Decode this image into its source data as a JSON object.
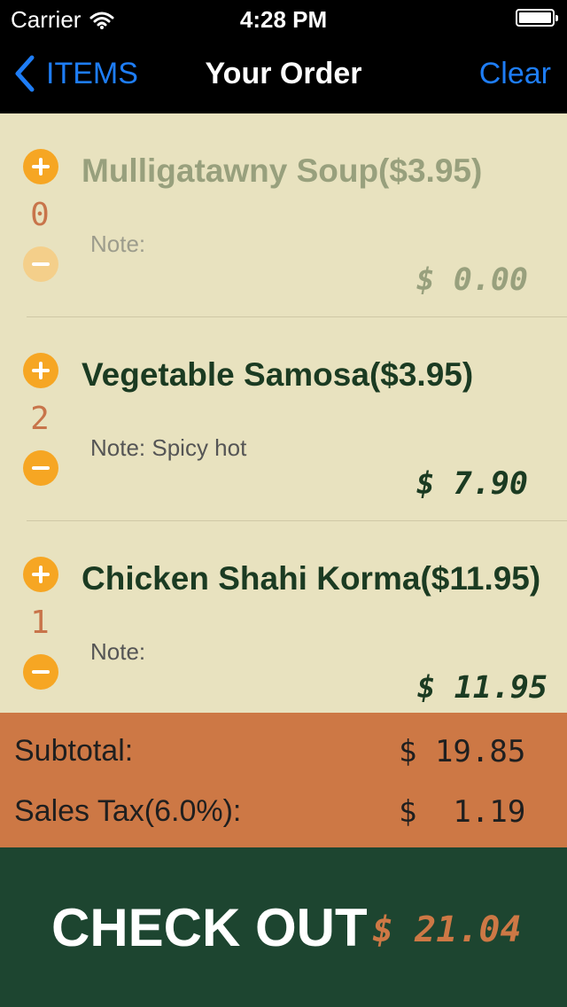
{
  "status_bar": {
    "carrier": "Carrier",
    "time": "4:28 PM"
  },
  "nav": {
    "back_label": "ITEMS",
    "title": "Your Order",
    "clear_label": "Clear"
  },
  "items": [
    {
      "name": "Mulligatawny Soup($3.95)",
      "quantity": "0",
      "note": "Note:",
      "total": "$ 0.00"
    },
    {
      "name": "Vegetable Samosa($3.95)",
      "quantity": "2",
      "note": "Note: Spicy hot",
      "total": "$ 7.90"
    },
    {
      "name": "Chicken Shahi Korma($11.95)",
      "quantity": "1",
      "note": "Note:",
      "total": "$ 11.95"
    }
  ],
  "summary": {
    "subtotal_label": "Subtotal:",
    "subtotal_value": "$ 19.85",
    "tax_label": "Sales Tax(6.0%):",
    "tax_value": "$  1.19"
  },
  "checkout": {
    "label": "CHECK OUT",
    "total": "$ 21.04"
  },
  "colors": {
    "accent_blue": "#1e7df6",
    "list_bg": "#e8e2bf",
    "summary_bg": "#cd7845",
    "checkout_bg": "#1d4530",
    "button_orange": "#f6a623"
  },
  "icons": [
    "wifi-icon",
    "battery-icon",
    "chevron-left-icon",
    "plus-icon",
    "minus-icon"
  ]
}
